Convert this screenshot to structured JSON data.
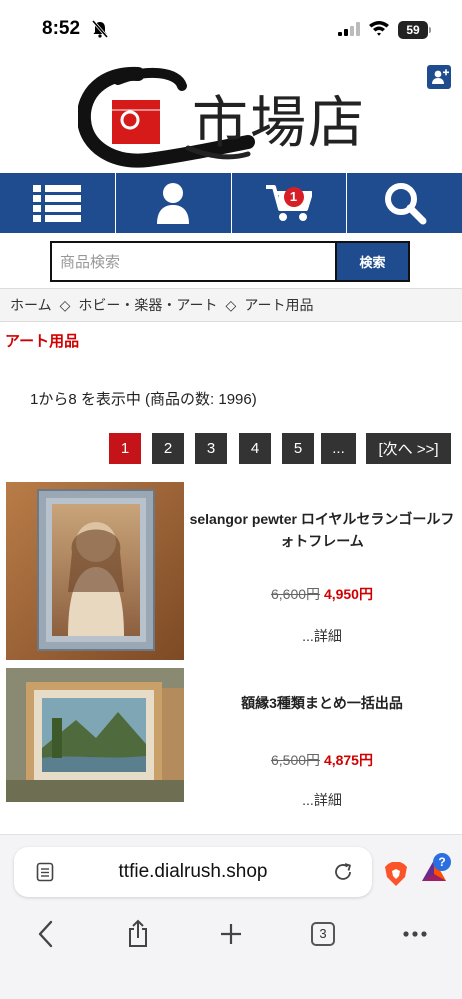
{
  "status": {
    "time": "8:52",
    "battery": "59"
  },
  "header": {
    "logo_text": "市場店"
  },
  "nav": {
    "items": [
      "menu-list",
      "account",
      "cart",
      "search"
    ],
    "cart_count": "1"
  },
  "search": {
    "placeholder": "商品検索",
    "button_label": "検索"
  },
  "breadcrumb": {
    "items": [
      "ホーム",
      "◇",
      "ホビー・楽器・アート",
      "◇",
      "アート用品"
    ]
  },
  "category": {
    "title": "アート用品"
  },
  "results": {
    "count_text": "1から8 を表示中 (商品の数: 1996)"
  },
  "pagination": {
    "pages": [
      "1",
      "2",
      "3",
      "4",
      "5",
      "..."
    ],
    "next_label": "[次へ >>]",
    "active": "1"
  },
  "products": [
    {
      "name": "selangor pewter ロイヤルセランゴールフォトフレーム",
      "old_price": "6,600円",
      "new_price": "4,950円",
      "detail": "...詳細"
    },
    {
      "name": "額縁3種類まとめ一括出品",
      "old_price": "6,500円",
      "new_price": "4,875円",
      "detail": "...詳細"
    }
  ],
  "browser": {
    "url": "ttfie.dialrush.shop",
    "tab_count": "3",
    "bat_badge": "?"
  },
  "colors": {
    "nav_blue": "#1f4b8f",
    "price_red": "#d00000",
    "active_page": "#c4141a"
  }
}
